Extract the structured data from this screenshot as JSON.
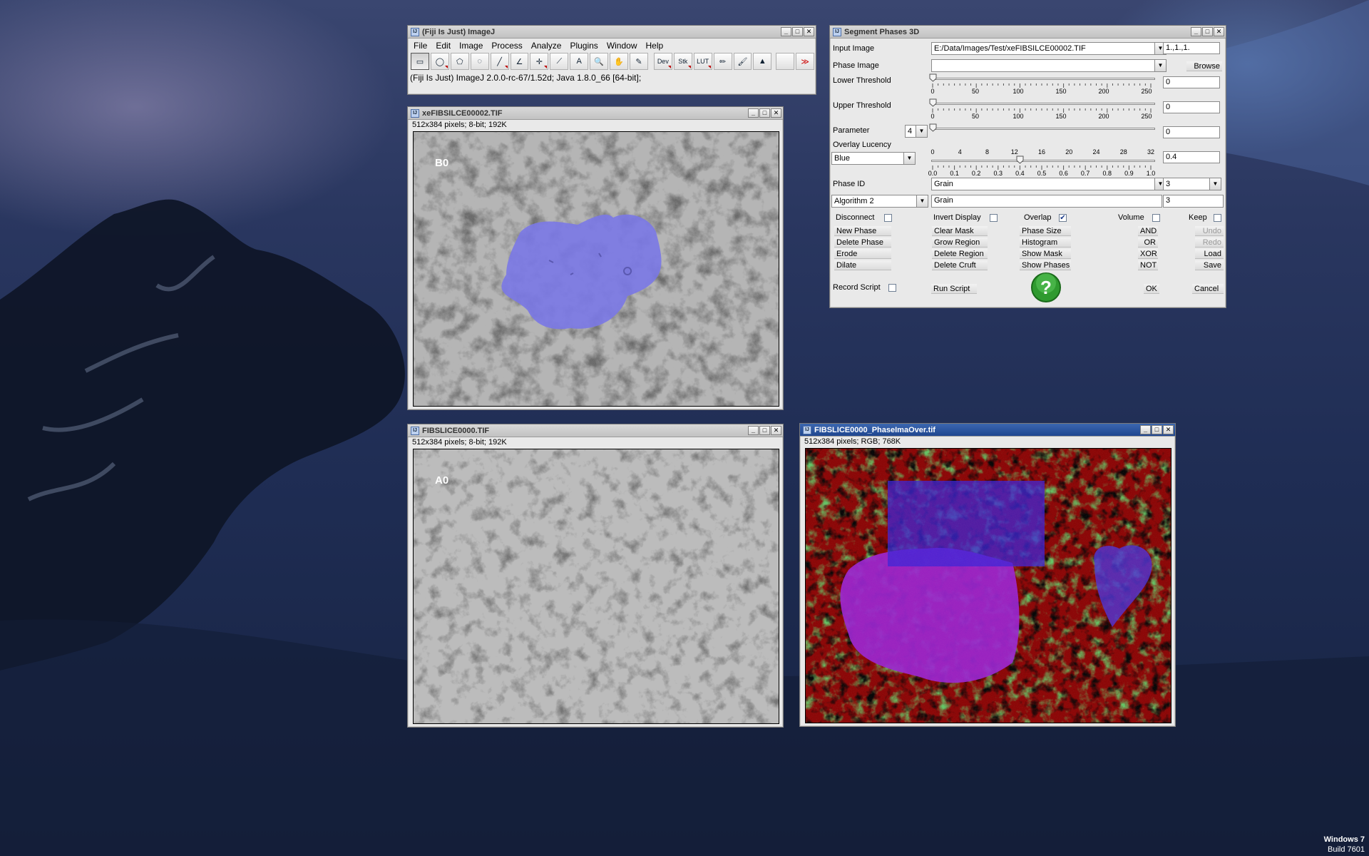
{
  "imagej": {
    "title": "(Fiji Is Just) ImageJ",
    "menus": [
      "File",
      "Edit",
      "Image",
      "Process",
      "Analyze",
      "Plugins",
      "Window",
      "Help"
    ],
    "tools": [
      {
        "name": "rectangle-tool",
        "glyph": "▭"
      },
      {
        "name": "oval-tool",
        "glyph": "◯"
      },
      {
        "name": "polygon-tool",
        "glyph": "⬠"
      },
      {
        "name": "freehand-tool",
        "glyph": "◌"
      },
      {
        "name": "line-tool",
        "glyph": "╱"
      },
      {
        "name": "angle-tool",
        "glyph": "∠"
      },
      {
        "name": "point-tool",
        "glyph": "✛"
      },
      {
        "name": "wand-tool",
        "glyph": "⟋"
      },
      {
        "name": "text-tool",
        "glyph": "A"
      },
      {
        "name": "magnifier-tool",
        "glyph": "🔍"
      },
      {
        "name": "hand-tool",
        "glyph": "✋"
      },
      {
        "name": "dropper-tool",
        "glyph": "✎"
      },
      {
        "name": "dev-tool",
        "glyph": "Dev"
      },
      {
        "name": "stk-tool",
        "glyph": "Stk"
      },
      {
        "name": "lut-tool",
        "glyph": "LUT"
      },
      {
        "name": "pencil-tool",
        "glyph": "✏"
      },
      {
        "name": "brush-tool",
        "glyph": "🖌"
      },
      {
        "name": "flood-fill-tool",
        "glyph": "▲"
      },
      {
        "name": "blank-tool",
        "glyph": ""
      },
      {
        "name": "more-tools",
        "glyph": "≫"
      }
    ],
    "status": "(Fiji Is Just) ImageJ 2.0.0-rc-67/1.52d; Java 1.8.0_66 [64-bit];"
  },
  "win_b": {
    "title": "xeFIBSILCE00002.TIF",
    "info": "512x384 pixels; 8-bit; 192K",
    "overlay_label": "B0"
  },
  "win_a": {
    "title": "FIBSLICE0000.TIF",
    "info": "512x384 pixels; 8-bit; 192K",
    "overlay_label": "A0"
  },
  "win_p": {
    "title": "FIBSLICE0000_PhaseImaOver.tif",
    "info": "512x384 pixels; RGB; 768K"
  },
  "seg": {
    "title": "Segment Phases 3D",
    "input_image_label": "Input Image",
    "input_image_value": "E:/Data/Images/Test/xeFIBSILCE00002.TIF",
    "input_extra": "1.,1.,1.",
    "phase_image_label": "Phase Image",
    "phase_image_value": "",
    "browse": "Browse",
    "lower_label": "Lower Threshold",
    "lower_value": "0",
    "upper_label": "Upper Threshold",
    "upper_value": "0",
    "param_label": "Parameter",
    "param_select": "4",
    "param_value": "0",
    "lucency_label": "Overlay Lucency",
    "color_select": "Blue",
    "lucency_value": "0.4",
    "phaseid_label": "Phase ID",
    "phaseid_name": "Grain",
    "phaseid_num": "3",
    "algo_select": "Algorithm 2",
    "algo_name": "Grain",
    "algo_num": "3",
    "slider_levels": {
      "lower": 0,
      "upper": 0,
      "param": 0,
      "lucency": 0.4
    },
    "ticks_256": [
      "0",
      "50",
      "100",
      "150",
      "200",
      "250"
    ],
    "ticks_32": [
      "0",
      "4",
      "8",
      "12",
      "16",
      "20",
      "24",
      "28",
      "32"
    ],
    "ticks_1": [
      "0.0",
      "0.1",
      "0.2",
      "0.3",
      "0.4",
      "0.5",
      "0.6",
      "0.7",
      "0.8",
      "0.9",
      "1.0"
    ],
    "checks": {
      "disconnect": "Disconnect",
      "invert": "Invert Display",
      "overlap": "Overlap",
      "volume": "Volume",
      "keep": "Keep"
    },
    "overlap_checked": true,
    "col1": [
      "New Phase",
      "Delete Phase",
      "Erode",
      "Dilate"
    ],
    "col2": [
      "Clear Mask",
      "Grow Region",
      "Delete Region",
      "Delete Cruft"
    ],
    "col3": [
      "Phase Size",
      "Histogram",
      "Show Mask",
      "Show Phases"
    ],
    "col4": [
      "AND",
      "OR",
      "XOR",
      "NOT"
    ],
    "col5": [
      "Undo",
      "Redo",
      "Load",
      "Save"
    ],
    "record": "Record Script",
    "run": "Run Script",
    "ok": "OK",
    "cancel": "Cancel"
  },
  "colors": {
    "overlay_blue": "#7a78e6",
    "phase_red": "#8a0000",
    "phase_green": "#1f8a1f",
    "phase_purple": "#9a1fd0",
    "phase_blue": "#3a1fd8",
    "titlebar_active": "#1f4690"
  },
  "taskbar": {
    "os": "Windows 7",
    "build": "Build 7601"
  }
}
